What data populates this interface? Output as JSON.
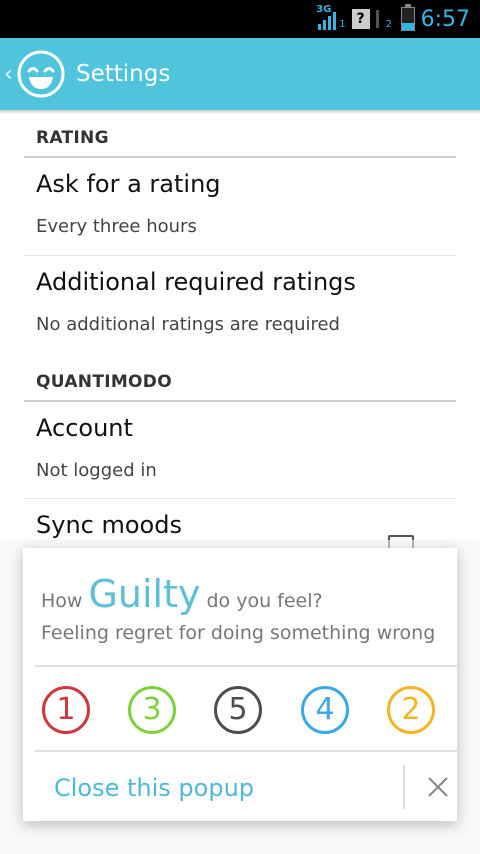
{
  "status_bar": {
    "network": "3G",
    "sim1_sub": "1",
    "sim2_sub": "2",
    "unknown_sim_icon": "question-sim-icon",
    "time": "6:57"
  },
  "action_bar": {
    "title": "Settings",
    "back_icon": "chevron-left-icon",
    "logo_icon": "smiley-logo-icon",
    "color": "#4fc4dc"
  },
  "sections": [
    {
      "header": "RATING",
      "items": [
        {
          "title": "Ask for a rating",
          "subtitle": "Every three hours"
        },
        {
          "title": "Additional required ratings",
          "subtitle": "No additional ratings are required"
        }
      ]
    },
    {
      "header": "QUANTIMODO",
      "items": [
        {
          "title": "Account",
          "subtitle": "Not logged in"
        },
        {
          "title": "Sync moods",
          "checked": false
        }
      ]
    }
  ],
  "popup": {
    "prefix": "How",
    "mood": "Guilty",
    "suffix": "do you feel?",
    "description": "Feeling regret for doing something wrong",
    "ratings": [
      {
        "label": "1",
        "color": "#d0363d"
      },
      {
        "label": "3",
        "color": "#7fd13b"
      },
      {
        "label": "5",
        "color": "#4d4d4d"
      },
      {
        "label": "4",
        "color": "#3ba7e3"
      },
      {
        "label": "2",
        "color": "#f5b423"
      }
    ],
    "close_label": "Close this popup",
    "close_icon": "close-icon"
  }
}
